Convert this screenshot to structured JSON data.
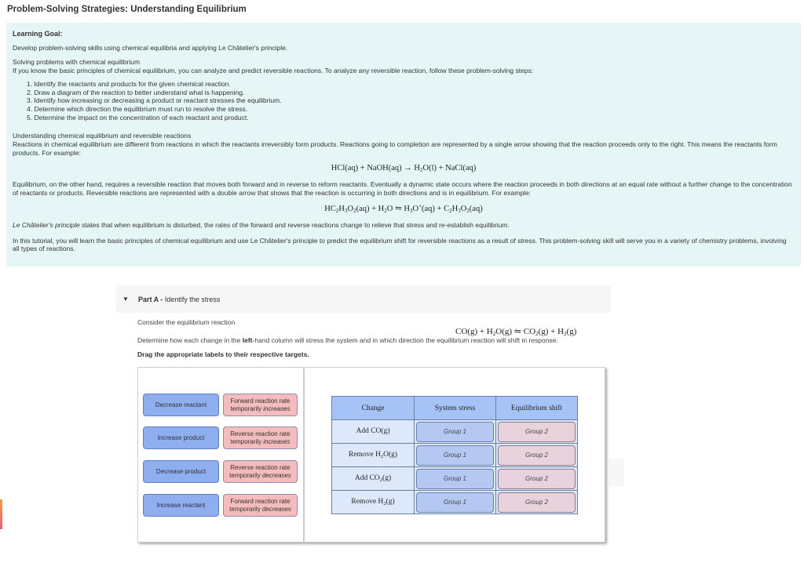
{
  "page": {
    "title": "Problem-Solving Strategies: Understanding Equilibrium"
  },
  "intro": {
    "learning_goal_label": "Learning Goal:",
    "learning_goal_text": "Develop problem-solving skills using chemical equilibria and applying Le Châtelier's principle.",
    "solving_heading": "Solving problems with chemical equilibrium",
    "solving_text": "If you know the basic principles of chemical equilibrium, you can analyze and predict reversible reactions. To analyze any reversible reaction, follow these problem-solving steps:",
    "steps": [
      "1. Identify the reactants and products for the given chemical reaction.",
      "2. Draw a diagram of the reaction to better understand what is happening.",
      "3. Identify how increasing or decreasing a product or reactant stresses the equilibrium.",
      "4. Determine which direction the equilibrium must run to resolve the stress.",
      "5. Determine the impact on the concentration of each reactant and product."
    ],
    "understanding_heading": "Understanding chemical equilibrium and reversible reactions",
    "understanding_text": "Reactions in chemical equilibrium are different from reactions in which the reactants irreversibly form products. Reactions going to completion are represented by a single arrow showing that the reaction proceeds only to the right. This means the reactants form products. For example:",
    "equation1": {
      "p1": "HCl(aq) + NaOH(aq) → H",
      "s1": "2",
      "p2": "O(l) + NaCl(aq)"
    },
    "equilibrium_text": "Equilibrium, on the other hand, requires a reversible reaction that moves both forward and in reverse to reform reactants. Eventually a dynamic state occurs where the reaction proceeds in both directions at an equal rate without a further change to the concentration of reactants or products. Reversible reactions are represented with a double arrow that shows that the reaction is occurring in both directions and is in equilibrium. For example:",
    "equation2": {
      "p1": "HC",
      "s1": "2",
      "p2": "H",
      "s2": "3",
      "p3": "O",
      "s3": "2",
      "p4": "(aq) + H",
      "s4": "2",
      "p5": "O ⇋ H",
      "s5": "3",
      "p6": "O",
      "sup6": "+",
      "p7": "(aq) + C",
      "s7": "2",
      "p8": "H",
      "s8": "3",
      "p9": "O",
      "s9": "2",
      "p10": "(aq)"
    },
    "le_chatelier_em": "Le Châtelier's principle",
    "le_chatelier_rest": " states that when equilibrium is disturbed, the rates of the forward and reverse reactions change to relieve that stress and re-establish equilibrium.",
    "tutorial_text": "In this tutorial, you will learn the basic principles of chemical equilibrium and use Le Châtelier's principle to predict the equilibrium shift for reversible reactions as a result of stress. This problem-solving skill will serve you in a variety of chemistry problems, involving all types of reactions."
  },
  "part_a": {
    "label_bold": "Part A - ",
    "label_text": "Identify the stress",
    "consider_text": "Consider the equilibrium reaction",
    "equation": {
      "p1": "CO(g) + H",
      "s1": "2",
      "p2": "O(g) ⇋ CO",
      "s2": "2",
      "p3": "(g) + H",
      "s3": "2",
      "p4": "(g)"
    },
    "determine_pre": "Determine how each change in the ",
    "determine_bold": "left",
    "determine_post": "-hand column will stress the system and in which direction the equilibrium reaction will shift in response.",
    "drag_instruction": "Drag the appropriate labels to their respective targets."
  },
  "labels": {
    "blue": [
      "Decrease reactant",
      "Increase product",
      "Decrease product",
      "Increase reactant"
    ],
    "pink": [
      {
        "line1": "Forward reaction rate",
        "line2_pre": "temporarily ",
        "line2_em": "increases"
      },
      {
        "line1": "Reverse reaction rate",
        "line2_pre": "temporarily ",
        "line2_em": "increases"
      },
      {
        "line1": "Reverse reaction rate",
        "line2_pre": "temporarily ",
        "line2_em": "decreases"
      },
      {
        "line1": "Forward reaction rate",
        "line2_pre": "temporarily ",
        "line2_em": "decreases"
      }
    ]
  },
  "table": {
    "headers": [
      "Change",
      "System stress",
      "Equilibrium shift"
    ],
    "rows": [
      {
        "change_pre": "Add CO(g)",
        "change_sub": "",
        "change_post": "",
        "stress": "Group 1",
        "shift": "Group 2"
      },
      {
        "change_pre": "Remove H",
        "change_sub": "2",
        "change_post": "O(g)",
        "stress": "Group 1",
        "shift": "Group 2"
      },
      {
        "change_pre": "Add CO",
        "change_sub": "2",
        "change_post": "(g)",
        "stress": "Group 1",
        "shift": "Group 2"
      },
      {
        "change_pre": "Remove H",
        "change_sub": "2",
        "change_post": "(g)",
        "stress": "Group 1",
        "shift": "Group 2"
      }
    ]
  },
  "icons": {
    "collapse": "▼"
  },
  "colors": {
    "intro_bg": "#e6f6f7",
    "label_blue": "#8eaef0",
    "label_pink": "#f4bcbc",
    "table_header": "#a6c3f7",
    "table_cell": "#dde9fb",
    "drop_blue": "#b5c8f1",
    "drop_pink": "#e8d3dc"
  }
}
